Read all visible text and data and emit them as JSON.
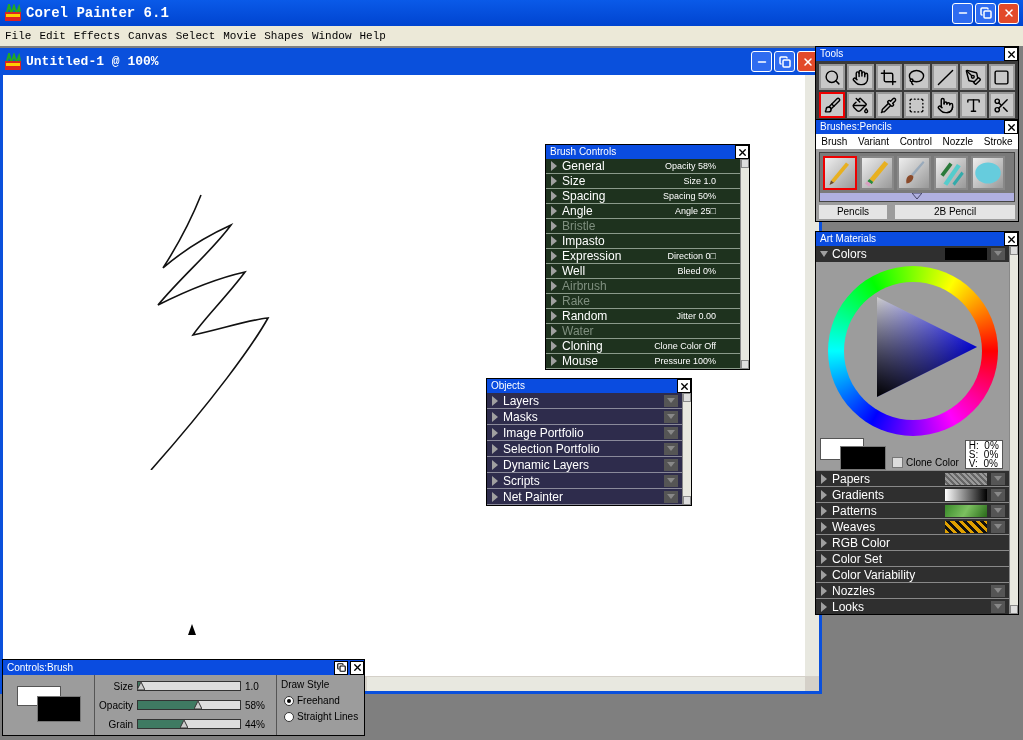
{
  "app": {
    "title": "Corel Painter 6.1"
  },
  "menu": [
    "File",
    "Edit",
    "Effects",
    "Canvas",
    "Select",
    "Movie",
    "Shapes",
    "Window",
    "Help"
  ],
  "document": {
    "title": "Untitled-1 @ 100%"
  },
  "brush_controls": {
    "title": "Brush Controls",
    "sections": [
      {
        "label": "General",
        "value": "Opacity 58%",
        "disabled": false
      },
      {
        "label": "Size",
        "value": "Size 1.0",
        "disabled": false
      },
      {
        "label": "Spacing",
        "value": "Spacing 50%",
        "disabled": false
      },
      {
        "label": "Angle",
        "value": "Angle 25□",
        "disabled": false
      },
      {
        "label": "Bristle",
        "disabled": true
      },
      {
        "label": "Impasto",
        "disabled": false
      },
      {
        "label": "Expression",
        "value": "Direction 0□",
        "disabled": false
      },
      {
        "label": "Well",
        "value": "Bleed 0%",
        "disabled": false
      },
      {
        "label": "Airbrush",
        "disabled": true
      },
      {
        "label": "Rake",
        "disabled": true
      },
      {
        "label": "Random",
        "value": "Jitter 0.00",
        "disabled": false
      },
      {
        "label": "Water",
        "disabled": true
      },
      {
        "label": "Cloning",
        "value": "Clone Color Off",
        "disabled": false
      },
      {
        "label": "Mouse",
        "value": "Pressure 100%",
        "disabled": false
      }
    ]
  },
  "objects": {
    "title": "Objects",
    "sections": [
      "Layers",
      "Masks",
      "Image Portfolio",
      "Selection Portfolio",
      "Dynamic Layers",
      "Scripts",
      "Net Painter"
    ]
  },
  "tools": {
    "title": "Tools",
    "items": [
      {
        "kind": "magnifier",
        "selected": false
      },
      {
        "kind": "hand",
        "selected": false
      },
      {
        "kind": "crop",
        "selected": false
      },
      {
        "kind": "lasso",
        "selected": false
      },
      {
        "kind": "line",
        "selected": false
      },
      {
        "kind": "pen",
        "selected": false
      },
      {
        "kind": "rectangle",
        "selected": false
      },
      {
        "kind": "brush",
        "selected": true
      },
      {
        "kind": "bucket",
        "selected": false
      },
      {
        "kind": "dropper",
        "selected": false
      },
      {
        "kind": "marquee",
        "selected": false
      },
      {
        "kind": "pointer",
        "selected": false
      },
      {
        "kind": "text",
        "selected": false
      },
      {
        "kind": "scissors",
        "selected": false
      }
    ]
  },
  "brushes": {
    "title": "Brushes:Pencils",
    "menu": [
      "Brush",
      "Variant",
      "Control",
      "Nozzle",
      "Stroke"
    ],
    "items": [
      {
        "kind": "pencil",
        "selected": true
      },
      {
        "kind": "eraser",
        "selected": false
      },
      {
        "kind": "paintbrush",
        "selected": false
      },
      {
        "kind": "pastel",
        "selected": false
      },
      {
        "kind": "cloth",
        "selected": false
      }
    ],
    "category": "Pencils",
    "variant": "2B Pencil"
  },
  "art_materials": {
    "title": "Art Materials",
    "colors": {
      "label": "Colors",
      "expanded": true
    },
    "hsv": [
      "H:  0%",
      "S:  0%",
      "V:  0%"
    ],
    "clone_color": {
      "label": "Clone Color",
      "checked": false
    },
    "sections": [
      {
        "label": "Papers",
        "kind": "paper",
        "dropdown": true
      },
      {
        "label": "Gradients",
        "kind": "gradient",
        "dropdown": true
      },
      {
        "label": "Patterns",
        "kind": "pattern",
        "dropdown": true
      },
      {
        "label": "Weaves",
        "kind": "weave",
        "dropdown": true
      },
      {
        "label": "RGB Color",
        "kind": "plain",
        "dropdown": false
      },
      {
        "label": "Color Set",
        "kind": "plain",
        "dropdown": false
      },
      {
        "label": "Color Variability",
        "kind": "plain",
        "dropdown": false
      },
      {
        "label": "Nozzles",
        "kind": "plain",
        "dropdown": true
      },
      {
        "label": "Looks",
        "kind": "plain",
        "dropdown": true
      }
    ]
  },
  "controls_brush": {
    "title": "Controls:Brush",
    "sliders": [
      {
        "label": "Size",
        "level": 0.02,
        "reading": "1.0"
      },
      {
        "label": "Opacity",
        "level": 0.58,
        "reading": "58%"
      },
      {
        "label": "Grain",
        "level": 0.44,
        "reading": "44%"
      }
    ],
    "draw_style": {
      "title": "Draw Style",
      "options": [
        {
          "label": "Freehand",
          "selected": true
        },
        {
          "label": "Straight Lines",
          "selected": false
        }
      ]
    }
  }
}
